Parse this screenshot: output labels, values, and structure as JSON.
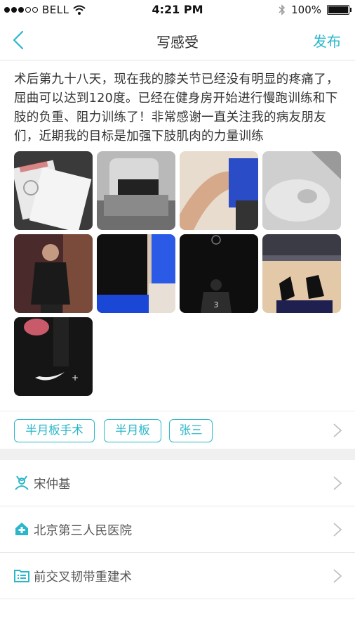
{
  "status_bar": {
    "carrier": "BELL",
    "time": "4:21 PM",
    "battery": "100%"
  },
  "nav": {
    "title": "写感受",
    "action": "发布"
  },
  "post": {
    "text": "术后第九十八天，现在我的膝关节已经没有明显的疼痛了，屈曲可以达到120度。已经在健身房开始进行慢跑训练和下肢的负重、阻力训练了！非常感谢一直关注我的病友朋友们，近期我的目标是加强下肢肌肉的力量训练",
    "photos": [
      {
        "name": "photo-certificate"
      },
      {
        "name": "photo-knee-brace"
      },
      {
        "name": "photo-legs"
      },
      {
        "name": "photo-knee"
      },
      {
        "name": "photo-man-portrait"
      },
      {
        "name": "photo-blue-sleeve"
      },
      {
        "name": "photo-basketball-player",
        "jersey": "3"
      },
      {
        "name": "photo-gym-court"
      },
      {
        "name": "photo-nike-shoe"
      }
    ]
  },
  "tags": [
    "半月板手术",
    "半月板",
    "张三"
  ],
  "info": {
    "doctor": "宋仲基",
    "hospital": "北京第三人民医院",
    "surgery": "前交叉韧带重建术"
  },
  "colors": {
    "accent": "#2ab7c9"
  }
}
